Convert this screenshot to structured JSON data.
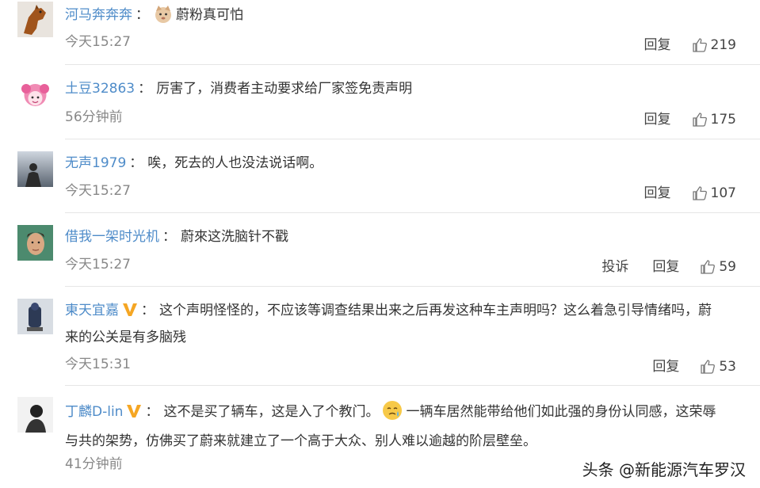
{
  "comments": [
    {
      "user": "河马奔奔奔",
      "text": "蔚粉真可怕",
      "time": "今天15:27",
      "reply": "回复",
      "likes": "219",
      "has_emoji": true,
      "avatar": "horse-avatar"
    },
    {
      "user": "土豆32863",
      "text": "厉害了，消费者主动要求给厂家签免责声明",
      "time": "56分钟前",
      "reply": "回复",
      "likes": "175",
      "avatar": "pink-cartoon-avatar"
    },
    {
      "user": "无声1979",
      "text": "唉，死去的人也没法说话啊。",
      "time": "今天15:27",
      "reply": "回复",
      "likes": "107",
      "avatar": "photo-avatar"
    },
    {
      "user": "借我一架时光机",
      "text": "蔚來这洗脑针不戳",
      "time": "今天15:27",
      "report": "投诉",
      "reply": "回复",
      "likes": "59",
      "avatar": "man-portrait-avatar"
    },
    {
      "user": "東天宜嘉",
      "verified": true,
      "text_line1": "这个声明怪怪的，不应该等调查结果出来之后再发这种车主声明吗？这么着急引导情绪吗，蔚",
      "text_line2": "来的公关是有多脑残",
      "time": "今天15:31",
      "reply": "回复",
      "likes": "53",
      "avatar": "figure-avatar"
    },
    {
      "user": "丁麟D-lin",
      "verified": true,
      "text_line1_a": "这不是买了辆车，这是入了个教门。",
      "text_line1_b": "一辆车居然能带给他们如此强的身份认同感，这荣辱",
      "text_line2": "与共的架势，仿佛买了蔚来就建立了一个高于大众、别人难以逾越的阶层壁垒。",
      "time": "41分钟前",
      "avatar": "bw-portrait-avatar"
    }
  ],
  "watermark": "头条 @新能源汽车罗汉",
  "colors": {
    "username": "#4f8cc9",
    "verified": "#f5a623",
    "meta": "#888888"
  }
}
